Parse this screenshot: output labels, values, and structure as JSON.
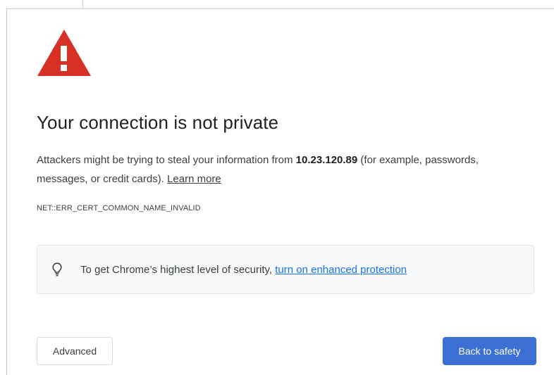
{
  "page": {
    "title": "Your connection is not private",
    "message": {
      "before_host": "Attackers might be trying to steal your information from ",
      "host": "10.23.120.89",
      "after_host": " (for example, passwords, messages, or credit cards). ",
      "learn_more": "Learn more"
    },
    "error_code": "NET::ERR_CERT_COMMON_NAME_INVALID"
  },
  "enhanced_protection": {
    "icon": "lightbulb-icon",
    "text": "To get Chrome’s highest level of security, ",
    "link": "turn on enhanced protection"
  },
  "buttons": {
    "advanced": "Advanced",
    "back_to_safety": "Back to safety"
  },
  "colors": {
    "warning_red": "#d93025",
    "link_blue": "#1a73e8",
    "primary_button": "#3b6fd4"
  }
}
